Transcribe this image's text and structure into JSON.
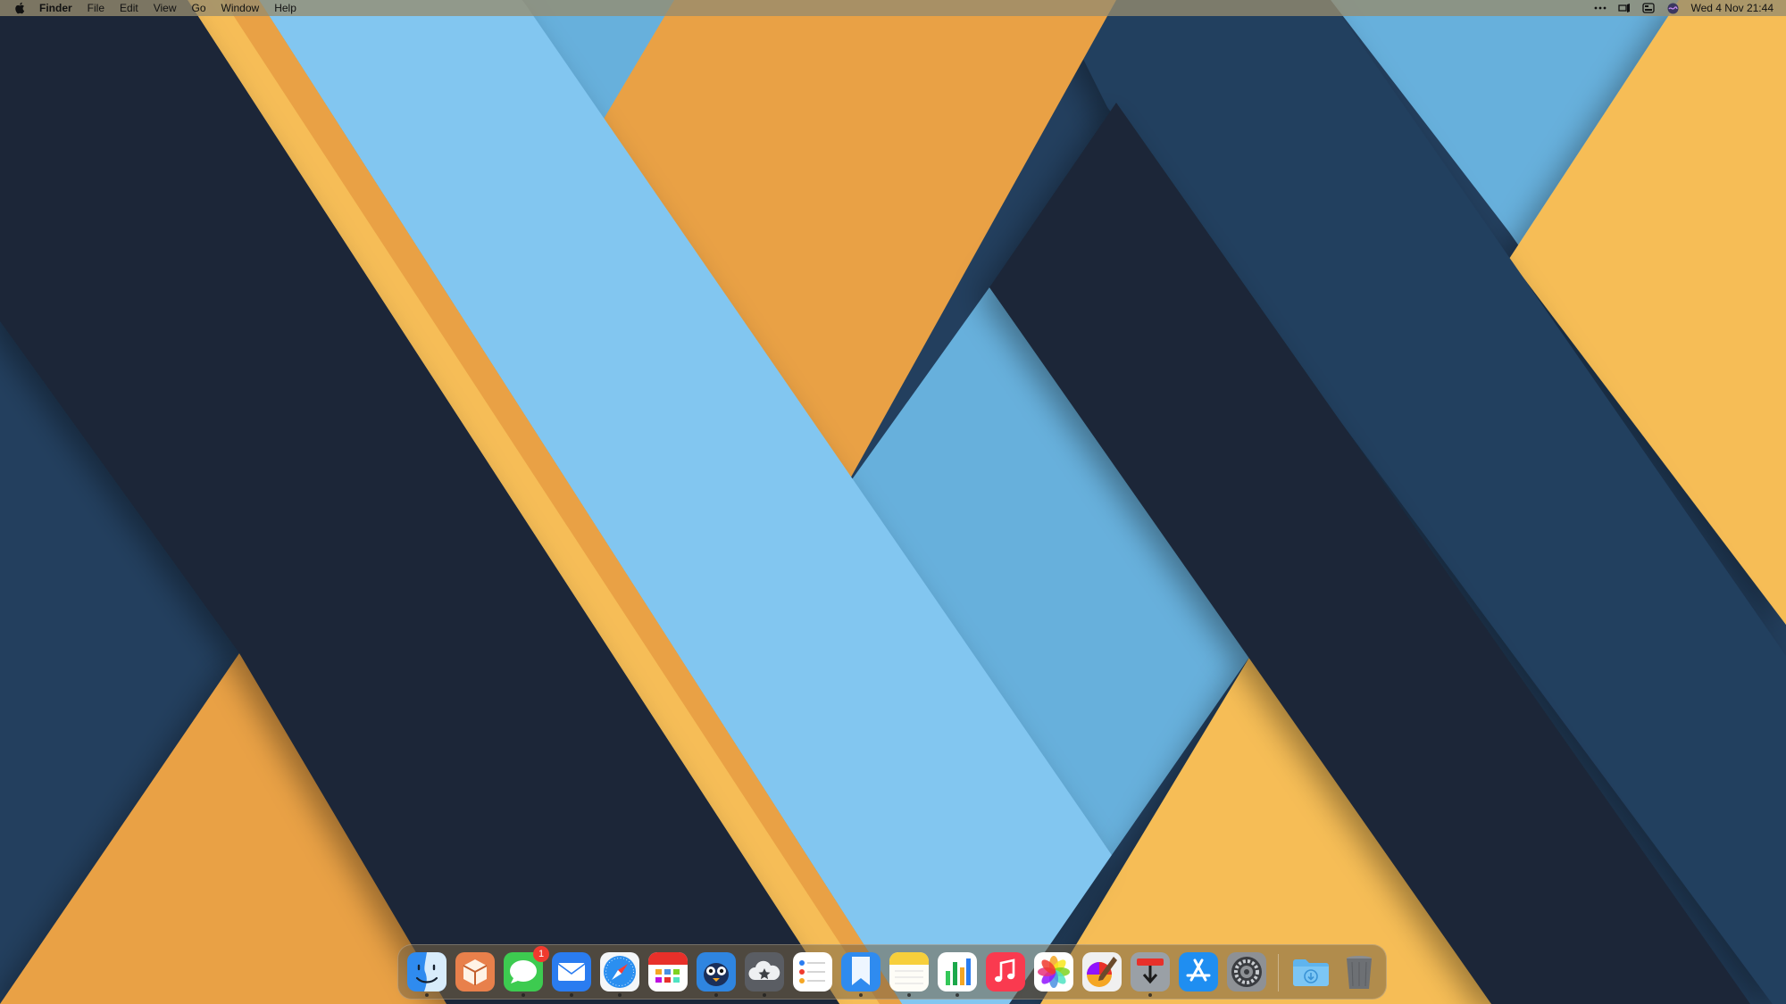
{
  "menubar": {
    "app_name": "Finder",
    "menus": [
      "File",
      "Edit",
      "View",
      "Go",
      "Window",
      "Help"
    ],
    "clock": "Wed 4 Nov  21:44",
    "status_icons": [
      "more-icon",
      "dropzone-icon",
      "control-center-icon",
      "siri-icon"
    ]
  },
  "dock": {
    "badges": {
      "messages": "1"
    },
    "apps": [
      {
        "name": "finder",
        "icon": "finder-icon",
        "running": true
      },
      {
        "name": "package",
        "icon": "package-icon",
        "running": false
      },
      {
        "name": "messages",
        "icon": "messages-icon",
        "running": true
      },
      {
        "name": "mail",
        "icon": "mail-icon",
        "running": true
      },
      {
        "name": "safari",
        "icon": "safari-icon",
        "running": true
      },
      {
        "name": "fantastical",
        "icon": "calendar-icon",
        "running": false
      },
      {
        "name": "tweetbot",
        "icon": "bird-icon",
        "running": true
      },
      {
        "name": "cloud-app",
        "icon": "cloud-star-icon",
        "running": true
      },
      {
        "name": "reminders",
        "icon": "reminders-icon",
        "running": false
      },
      {
        "name": "bookmarks",
        "icon": "bookmark-icon",
        "running": true
      },
      {
        "name": "notes",
        "icon": "notes-icon",
        "running": true
      },
      {
        "name": "numbers",
        "icon": "bar-chart-icon",
        "running": true
      },
      {
        "name": "music",
        "icon": "music-icon",
        "running": false
      },
      {
        "name": "photos",
        "icon": "photos-icon",
        "running": false
      },
      {
        "name": "pixelmator",
        "icon": "paint-icon",
        "running": false
      },
      {
        "name": "downloader",
        "icon": "download-icon",
        "running": true
      },
      {
        "name": "app-store",
        "icon": "app-store-icon",
        "running": false
      },
      {
        "name": "system-preferences",
        "icon": "gear-icon",
        "running": false
      },
      {
        "name": "downloads-folder",
        "icon": "downloads-folder-icon",
        "running": false
      },
      {
        "name": "trash",
        "icon": "trash-icon",
        "running": false
      }
    ]
  },
  "colors": {
    "navy_dark": "#1b2637",
    "navy": "#233f5e",
    "sky": "#82c6f0",
    "sky_mid": "#67b0dc",
    "orange": "#e9a145",
    "yellow": "#f6bd57"
  }
}
